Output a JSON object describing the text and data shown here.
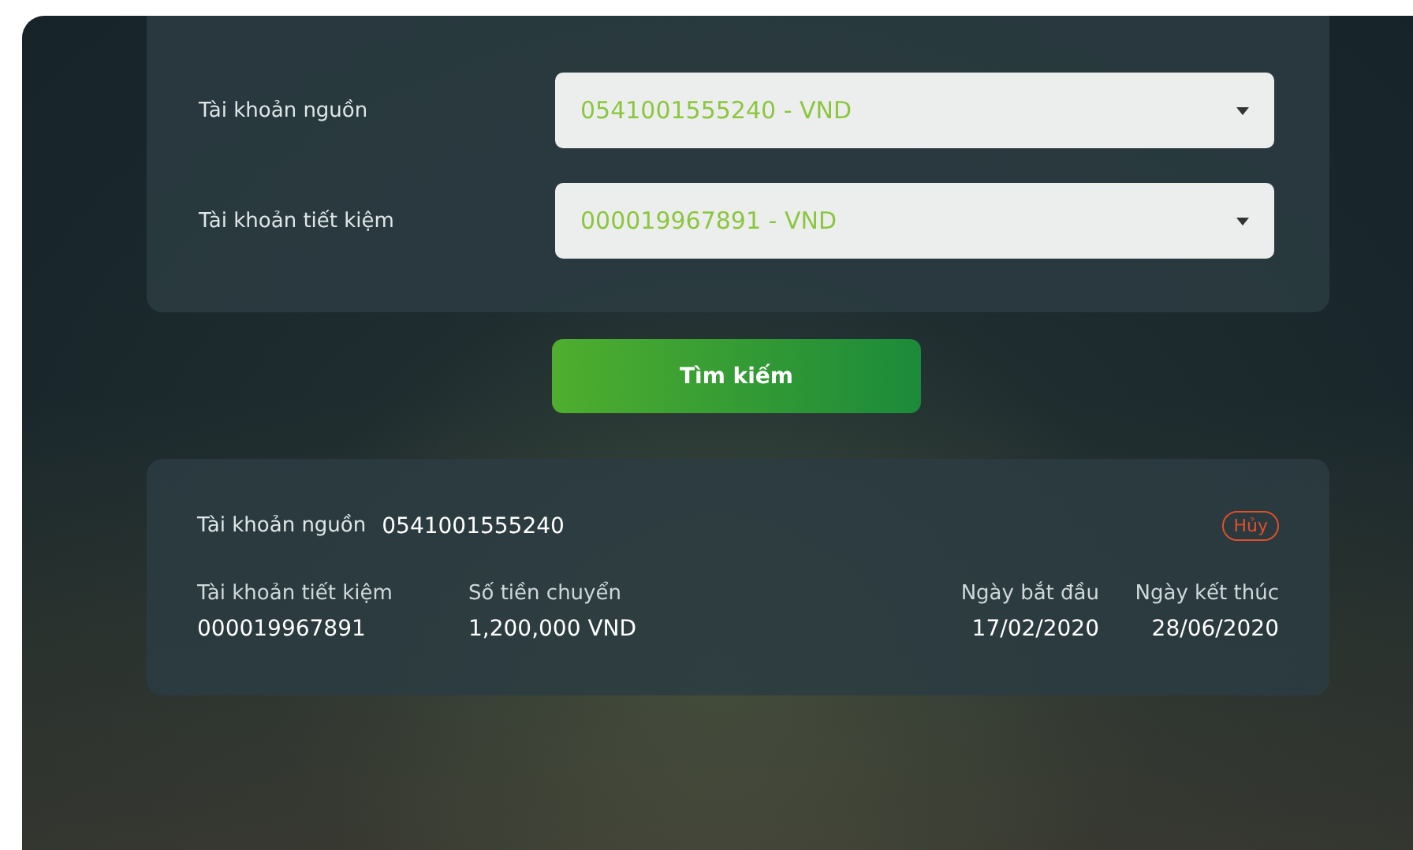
{
  "filter": {
    "fields": [
      {
        "label": "Tài khoản nguồn",
        "value": "0541001555240 - VND"
      },
      {
        "label": "Tài khoản tiết kiệm",
        "value": "000019967891 - VND"
      }
    ]
  },
  "search_button": "Tìm kiếm",
  "result": {
    "source_label": "Tài khoản nguồn",
    "source_value": "0541001555240",
    "cancel": "Hủy",
    "columns": [
      {
        "label": "Tài khoản tiết kiệm",
        "value": "000019967891"
      },
      {
        "label": "Số tiền chuyển",
        "value": "1,200,000 VND"
      },
      {
        "label": "Ngày bắt đầu",
        "value": "17/02/2020"
      },
      {
        "label": "Ngày kết thúc",
        "value": "28/06/2020"
      }
    ]
  }
}
